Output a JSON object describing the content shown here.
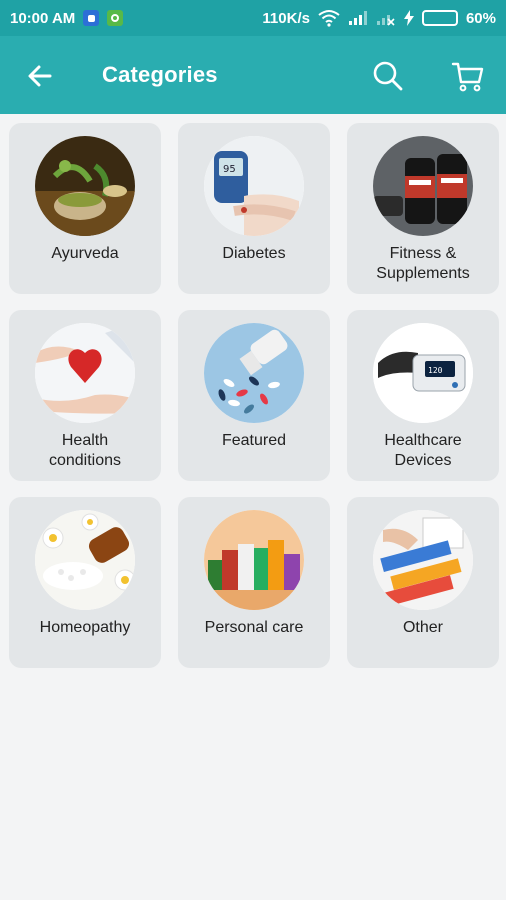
{
  "status_bar": {
    "time": "10:00 AM",
    "network_speed": "110K/s",
    "battery_percent": "60%",
    "battery_level": 0.6
  },
  "app_bar": {
    "title": "Categories",
    "back_icon": "arrow-left-icon",
    "search_icon": "search-icon",
    "cart_icon": "cart-icon"
  },
  "colors": {
    "status_bar": "#1fa2a5",
    "app_bar": "#2aadb0",
    "card_bg": "#e3e6e8",
    "page_bg": "#f3f4f5"
  },
  "categories": [
    {
      "label": "Ayurveda"
    },
    {
      "label": "Diabetes"
    },
    {
      "label": "Fitness &\nSupplements"
    },
    {
      "label": "Health\nconditions"
    },
    {
      "label": "Featured"
    },
    {
      "label": "Healthcare\nDevices"
    },
    {
      "label": "Homeopathy"
    },
    {
      "label": "Personal care"
    },
    {
      "label": "Other"
    }
  ]
}
